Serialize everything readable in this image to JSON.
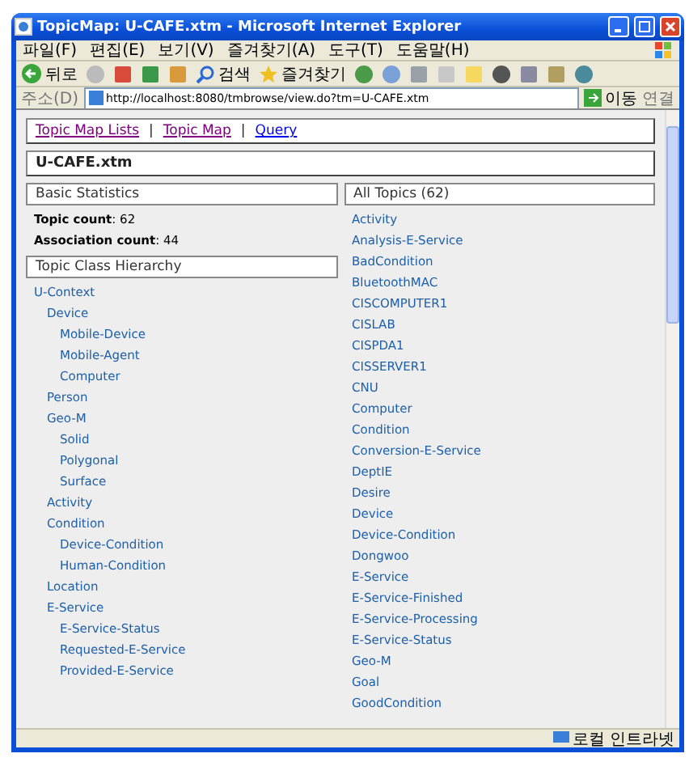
{
  "window": {
    "title": "TopicMap: U-CAFE.xtm - Microsoft Internet Explorer"
  },
  "menu": [
    "파일(F)",
    "편집(E)",
    "보기(V)",
    "즐겨찾기(A)",
    "도구(T)",
    "도움말(H)"
  ],
  "toolbar": {
    "back_label": "뒤로",
    "search_label": "검색",
    "favorites_label": "즐겨찾기"
  },
  "address_bar": {
    "label": "주소(D)",
    "url": "http://localhost:8080/tmbrowse/view.do?tm=U-CAFE.xtm",
    "go_label": "이동",
    "links_label": "연결"
  },
  "nav": {
    "separator": "|",
    "links": [
      {
        "label": "Topic Map Lists",
        "visited": true
      },
      {
        "label": "Topic Map",
        "visited": true
      },
      {
        "label": "Query",
        "visited": false
      }
    ]
  },
  "page_title": "U-CAFE.xtm",
  "basic_statistics": {
    "heading": "Basic Statistics",
    "stats": [
      "**Topic count**: 62",
      "**Association count**: 44"
    ]
  },
  "hierarchy": {
    "heading": "Topic Class Hierarchy",
    "items": [
      {
        "label": "U-Context",
        "children": [
          {
            "label": "Device",
            "children": [
              {
                "label": "Mobile-Device"
              },
              {
                "label": "Mobile-Agent"
              },
              {
                "label": "Computer"
              }
            ]
          },
          {
            "label": "Person"
          },
          {
            "label": "Geo-M",
            "children": [
              {
                "label": "Solid"
              },
              {
                "label": "Polygonal"
              },
              {
                "label": "Surface"
              }
            ]
          },
          {
            "label": "Activity"
          },
          {
            "label": "Condition",
            "children": [
              {
                "label": "Device-Condition"
              },
              {
                "label": "Human-Condition"
              }
            ]
          },
          {
            "label": "Location"
          },
          {
            "label": "E-Service",
            "children": [
              {
                "label": "E-Service-Status"
              },
              {
                "label": "Requested-E-Service"
              },
              {
                "label": "Provided-E-Service"
              }
            ]
          }
        ]
      }
    ]
  },
  "all_topics": {
    "heading": "All Topics (62)",
    "items": [
      "Activity",
      "Analysis-E-Service",
      "BadCondition",
      "BluetoothMAC",
      "CISCOMPUTER1",
      "CISLAB",
      "CISPDA1",
      "CISSERVER1",
      "CNU",
      "Computer",
      "Condition",
      "Conversion-E-Service",
      "DeptIE",
      "Desire",
      "Device",
      "Device-Condition",
      "Dongwoo",
      "E-Service",
      "E-Service-Finished",
      "E-Service-Processing",
      "E-Service-Status",
      "Geo-M",
      "Goal",
      "GoodCondition"
    ]
  },
  "status_bar": {
    "zone": "로컬 인트라넷"
  }
}
